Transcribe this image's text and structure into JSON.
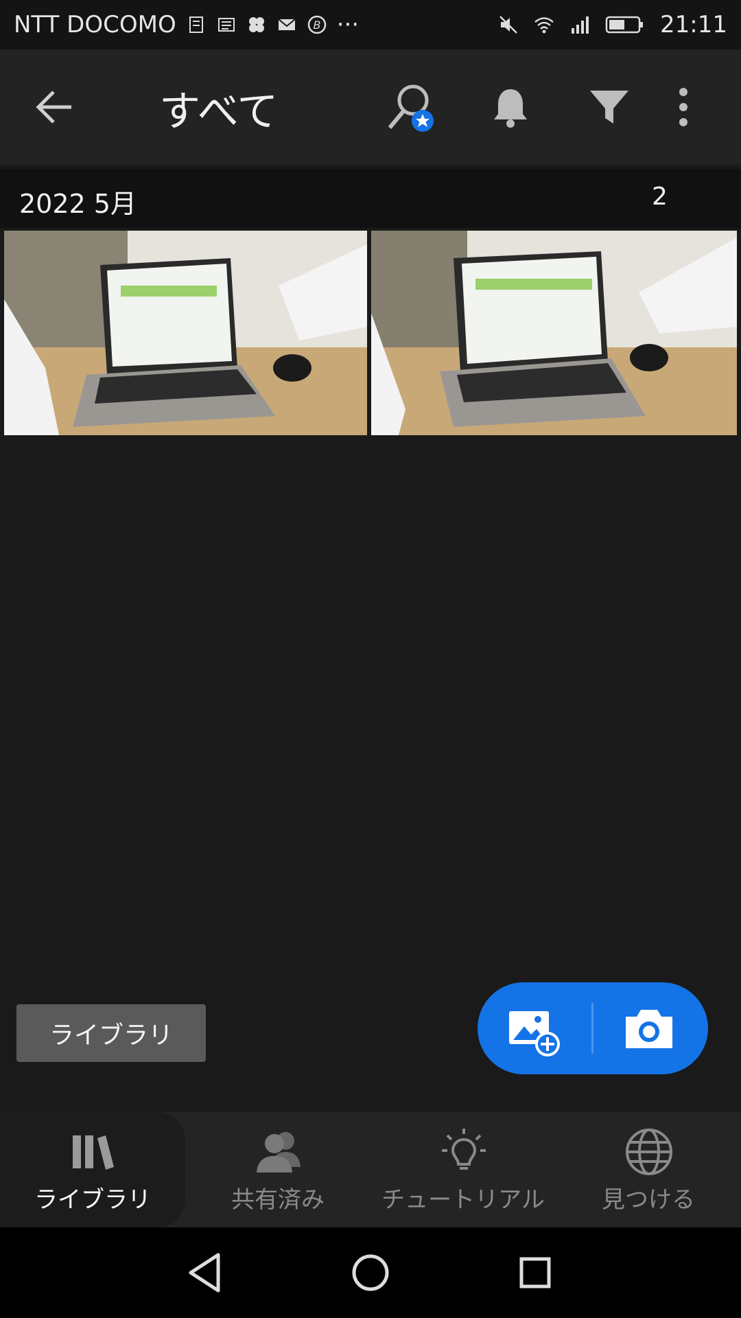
{
  "status_bar": {
    "carrier": "NTT DOCOMO",
    "dots": "···",
    "time": "21:11"
  },
  "toolbar": {
    "title": "すべて"
  },
  "section": {
    "date": "2022 5月",
    "count": "2"
  },
  "library_chip": {
    "label": "ライブラリ"
  },
  "fab": {
    "add_icon": "add-photo-icon",
    "camera_icon": "camera-icon"
  },
  "bottom_nav": {
    "items": [
      {
        "label": "ライブラリ",
        "icon": "library-icon",
        "active": true
      },
      {
        "label": "共有済み",
        "icon": "shared-people-icon",
        "active": false
      },
      {
        "label": "チュートリアル",
        "icon": "lightbulb-icon",
        "active": false
      },
      {
        "label": "見つける",
        "icon": "globe-icon",
        "active": false
      }
    ]
  },
  "colors": {
    "accent": "#1473e6",
    "background": "#1a1a1a",
    "toolbar": "#232323"
  }
}
